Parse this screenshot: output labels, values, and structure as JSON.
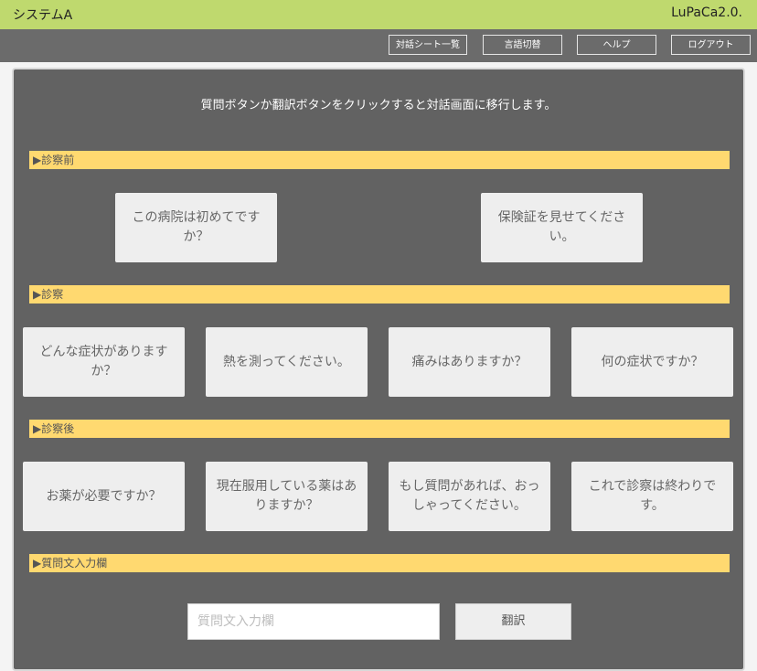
{
  "header": {
    "app_name": "システムA",
    "version": "LuPaCa2.0."
  },
  "nav": {
    "dialog_list": "対話シート一覧",
    "language_switch": "言語切替",
    "help": "ヘルプ",
    "logout": "ログアウト"
  },
  "main": {
    "instruction": "質問ボタンか翻訳ボタンをクリックすると対話画面に移行します。",
    "sections": [
      {
        "label": "▶診察前",
        "questions": [
          "この病院は初めてですか？",
          "保険証を見せてください。"
        ]
      },
      {
        "label": "▶診察",
        "questions": [
          "どんな症状がありますか？",
          "熱を測ってください。",
          "痛みはありますか？",
          "何の症状ですか？"
        ]
      },
      {
        "label": "▶診察後",
        "questions": [
          "お薬が必要ですか？",
          "現在服用している薬はありますか？",
          "もし質問があれば、おっしゃってください。",
          "これで診察は終わりです。"
        ]
      },
      {
        "label": "▶質問文入力欄"
      }
    ],
    "input_placeholder": "質問文入力欄",
    "translate_label": "翻訳"
  },
  "colors": {
    "header_bg": "#bfd96e",
    "nav_bg": "#6b6b6b",
    "panel_bg": "#626262",
    "section_bar": "#ffd970",
    "question_button": "#eeeeee"
  }
}
